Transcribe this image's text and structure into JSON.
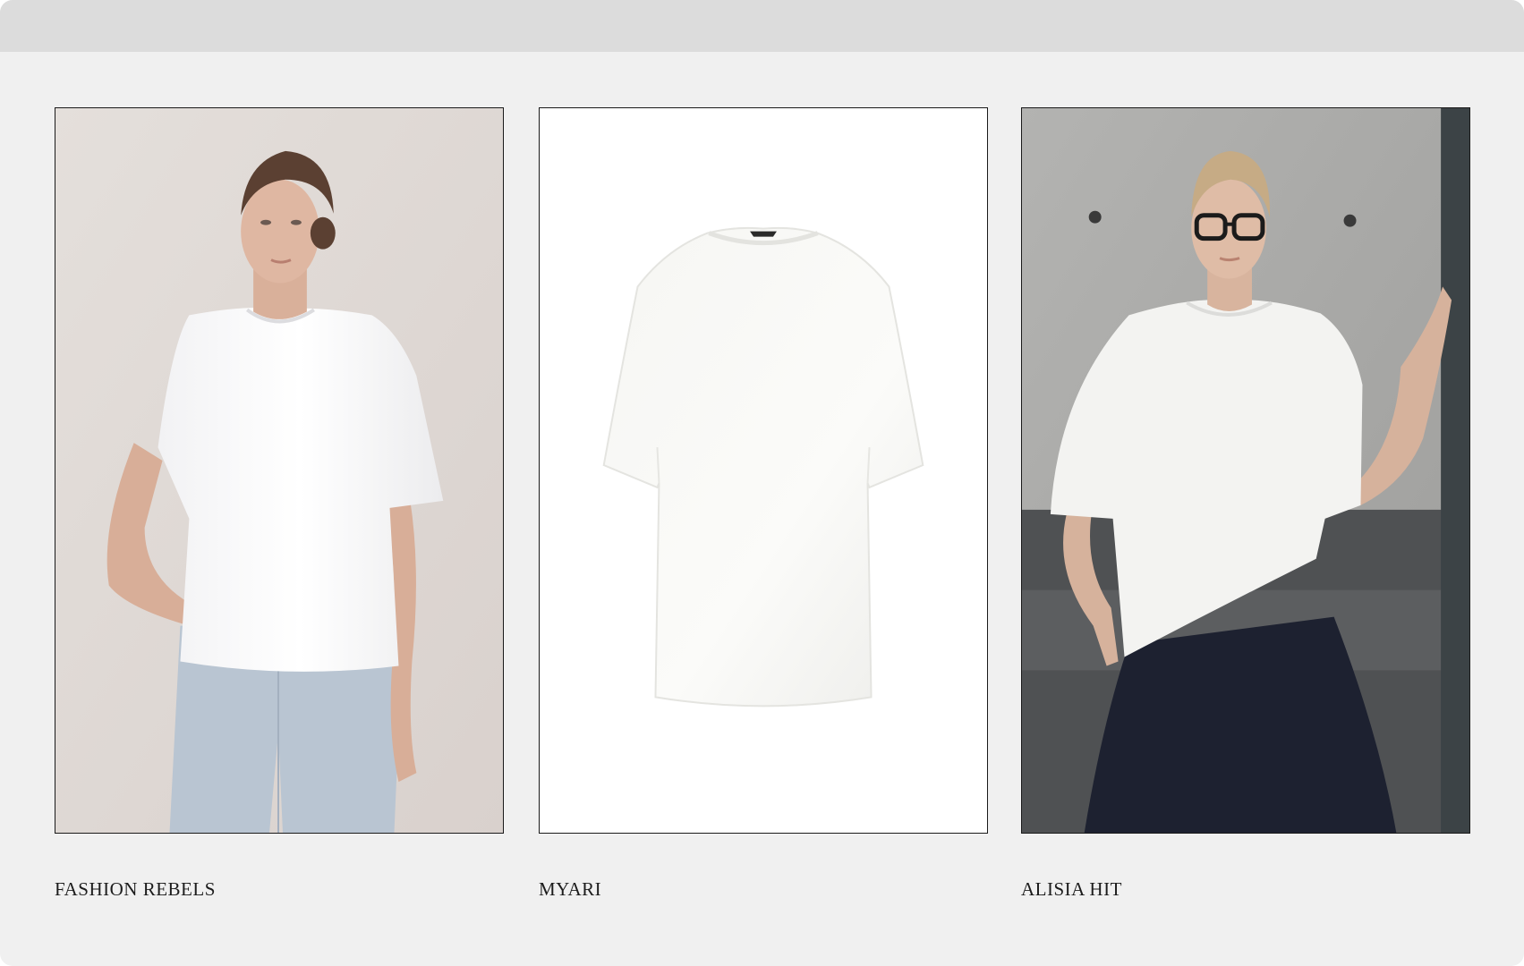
{
  "products": [
    {
      "brand": "FASHION REBELS",
      "image_subject": "model-in-white-tee-and-jeans"
    },
    {
      "brand": "MYARI",
      "image_subject": "white-tee-flat-lay"
    },
    {
      "brand": "ALISIA HIT",
      "image_subject": "model-in-white-tee-and-black-skirt"
    }
  ],
  "colors": {
    "page_background": "#f0f0f0",
    "top_bar": "#dcdcdc",
    "card_border": "#1a1a1a",
    "caption_text": "#1c1c1c"
  }
}
